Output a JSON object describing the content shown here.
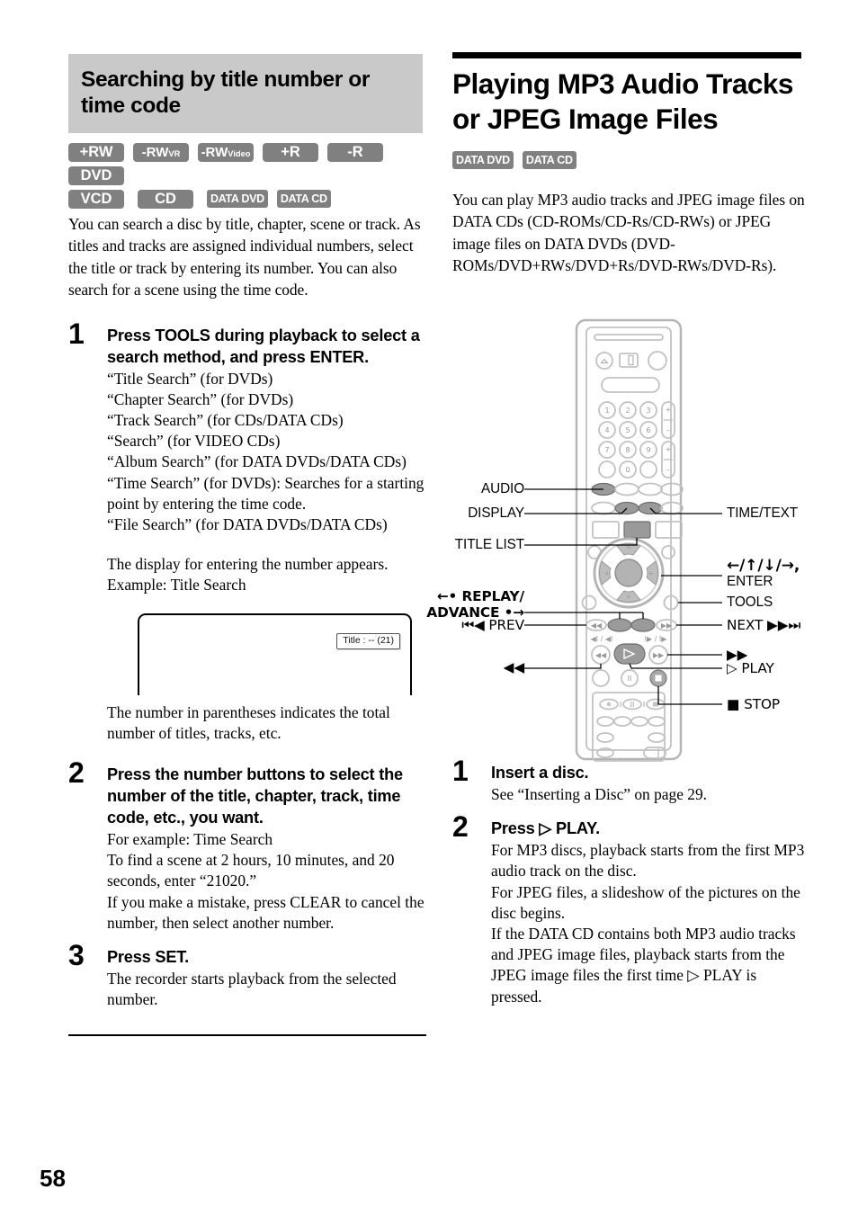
{
  "page": {
    "number": "58"
  },
  "left": {
    "section_heading": "Searching by title number or time code",
    "badges": [
      {
        "label": "+RW",
        "style": "wide"
      },
      {
        "label": "-RW",
        "sub": "VR",
        "style": "rw"
      },
      {
        "label": "-RW",
        "sub": "Video",
        "style": "rw"
      },
      {
        "label": "+R",
        "style": "wide"
      },
      {
        "label": "-R",
        "style": "wide"
      },
      {
        "label": "DVD",
        "style": "wide"
      },
      {
        "label": "VCD",
        "style": "wide"
      },
      {
        "label": "CD",
        "style": "wide"
      },
      {
        "label": "DATA DVD",
        "style": "data"
      },
      {
        "label": "DATA CD",
        "style": "data"
      }
    ],
    "intro": "You can search a disc by title, chapter, scene or track. As titles and tracks are assigned individual numbers, select the title or track by entering its number. You can also search for a scene using the time code.",
    "steps": [
      {
        "num": "1",
        "title": "Press TOOLS during playback to select a search method, and press ENTER.",
        "lines": [
          "“Title Search” (for DVDs)",
          "“Chapter Search” (for DVDs)",
          "“Track Search” (for CDs/DATA CDs)",
          "“Search” (for VIDEO CDs)",
          "“Album Search” (for DATA DVDs/DATA CDs)",
          "“Time Search” (for DVDs): Searches for a starting point by entering the time code.",
          "“File Search” (for DATA DVDs/DATA CDs)"
        ],
        "after": "The display for entering the number appears. Example: Title Search",
        "osd_label": "Title : -- (21)",
        "caption": "The number in parentheses indicates the total number of titles, tracks, etc."
      },
      {
        "num": "2",
        "title": "Press the number buttons to select the number of the title, chapter, track, time code, etc., you want.",
        "lines": [
          "For example: Time Search",
          "To find a scene at 2 hours, 10 minutes, and 20 seconds, enter “21020.”",
          "If you make a mistake, press CLEAR to cancel the number, then select another number."
        ]
      },
      {
        "num": "3",
        "title": "Press SET.",
        "lines": [
          "The recorder starts playback from the selected number."
        ]
      }
    ]
  },
  "right": {
    "chapter_heading": "Playing MP3 Audio Tracks or JPEG Image Files",
    "badges": [
      {
        "label": "DATA DVD",
        "style": "data"
      },
      {
        "label": "DATA CD",
        "style": "data"
      }
    ],
    "intro": "You can play MP3 audio tracks and JPEG image files on DATA CDs (CD-ROMs/CD-Rs/CD-RWs) or JPEG image files on DATA DVDs (DVD-ROMs/DVD+RWs/DVD+Rs/DVD-RWs/DVD-Rs).",
    "remote_callouts": {
      "left": [
        {
          "name": "audio",
          "text": "AUDIO"
        },
        {
          "name": "display",
          "text": "DISPLAY"
        },
        {
          "name": "title-list",
          "text": "TITLE LIST"
        },
        {
          "name": "replay-advance",
          "line1": "←• REPLAY/",
          "line2": "ADVANCE •→"
        },
        {
          "name": "prev",
          "text": "⏮◀ PREV"
        },
        {
          "name": "rewind",
          "text": "◀◀"
        }
      ],
      "right": [
        {
          "name": "time-text",
          "text": "TIME/TEXT"
        },
        {
          "name": "direction-enter",
          "line1": "←/↑/↓/→,",
          "line2": "ENTER"
        },
        {
          "name": "tools",
          "text": "TOOLS"
        },
        {
          "name": "next",
          "text": "NEXT ▶▶⏭"
        },
        {
          "name": "fast-forward",
          "text": "▶▶"
        },
        {
          "name": "play",
          "text": "▷ PLAY"
        },
        {
          "name": "stop",
          "text": "■ STOP"
        }
      ]
    },
    "keypad_digits": [
      "1",
      "2",
      "3",
      "4",
      "5",
      "6",
      "7",
      "8",
      "9",
      "0"
    ],
    "steps": [
      {
        "num": "1",
        "title": "Insert a disc.",
        "lines": [
          "See “Inserting a Disc” on page 29."
        ]
      },
      {
        "num": "2",
        "title": "Press ▷ PLAY.",
        "lines": [
          "For MP3 discs, playback starts from the first MP3 audio track on the disc.",
          "For JPEG files, a slideshow of the pictures on the disc begins.",
          "If the DATA CD contains both MP3 audio tracks and JPEG image files, playback starts from the JPEG image files the first time ▷ PLAY is pressed."
        ]
      }
    ]
  },
  "colors": {
    "badge_bg": "#808080",
    "heading_bg": "#c9c9c9",
    "rule": "#000000",
    "remote_outline": "#b4b4b4",
    "remote_button_highlight": "#9a9a9a"
  }
}
